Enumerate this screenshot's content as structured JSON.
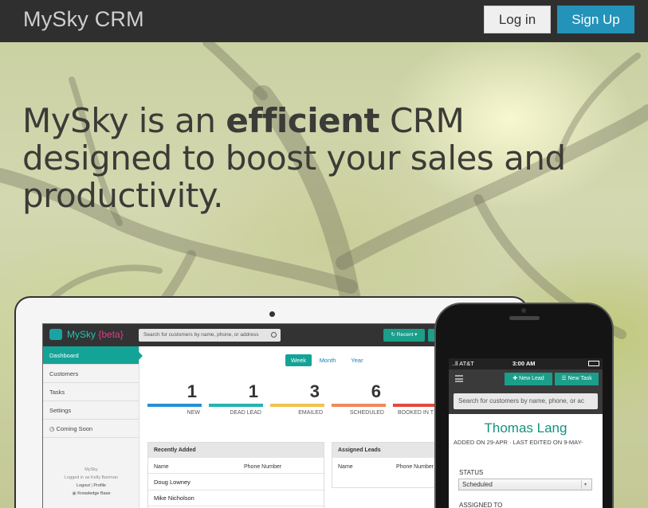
{
  "nav": {
    "brand": "MySky CRM",
    "login_label": "Log in",
    "signup_label": "Sign Up"
  },
  "hero": {
    "headline_pre": "MySky is an ",
    "headline_bold": "efficient",
    "headline_post": " CRM designed to boost your sales and productivity."
  },
  "laptop_app": {
    "name": "MySky",
    "beta": "{beta}",
    "search_placeholder": "Search for customers by name, phone, or address",
    "recent_label": "↻ Recent ▾",
    "sidebar": [
      "Dashboard",
      "Customers",
      "Tasks",
      "Settings",
      "Coming Soon"
    ],
    "footer": {
      "app": "MySky",
      "logged_in": "Logged in as Kelly Banman",
      "logout": "Logout",
      "sep": "|",
      "profile": "Profile",
      "kb": "Knowledge Base"
    },
    "periods": [
      "Week",
      "Month",
      "Year"
    ],
    "stats": [
      {
        "value": "1",
        "label": "NEW",
        "color": "#2b8fd6"
      },
      {
        "value": "1",
        "label": "DEAD LEAD",
        "color": "#23b3b3"
      },
      {
        "value": "3",
        "label": "EMAILED",
        "color": "#f2c250"
      },
      {
        "value": "6",
        "label": "SCHEDULED",
        "color": "#ef8a5b"
      },
      {
        "value": "",
        "label": "BOOKED IN T",
        "color": "#e24a3e"
      }
    ],
    "recently_added": {
      "title": "Recently Added",
      "col_name": "Name",
      "col_phone": "Phone Number",
      "rows": [
        "Doug Lowney",
        "Mike Nicholson"
      ]
    },
    "assigned_leads": {
      "title": "Assigned Leads",
      "col_name": "Name",
      "col_phone": "Phone Number"
    }
  },
  "phone_app": {
    "carrier": "..ll AT&T",
    "time": "3:00 AM",
    "new_lead": "✚ New Lead",
    "new_task": "☰ New Task",
    "search_placeholder": "Search for customers by name, phone, or ac",
    "contact_name": "Thomas Lang",
    "meta": "ADDED ON 29-APR · LAST EDITED ON 9-MAY-",
    "status_label": "STATUS",
    "status_value": "Scheduled",
    "assigned_label": "ASSIGNED TO"
  }
}
